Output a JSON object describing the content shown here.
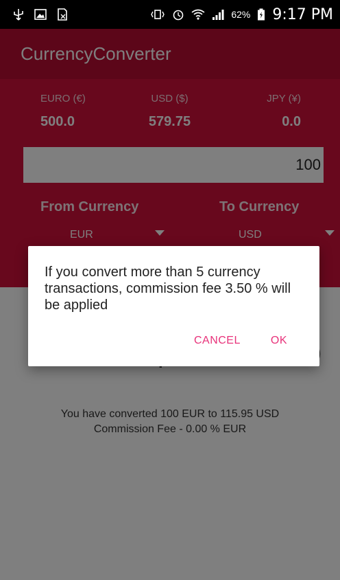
{
  "status_bar": {
    "battery": "62%",
    "time": "9:17 PM"
  },
  "toolbar": {
    "title": "CurrencyConverter"
  },
  "rates": [
    {
      "label": "EURO (€)",
      "value": "500.0"
    },
    {
      "label": "USD ($)",
      "value": "579.75"
    },
    {
      "label": "JPY (¥)",
      "value": "0.0"
    }
  ],
  "amount": {
    "value": "100"
  },
  "from": {
    "label": "From Currency",
    "selected": "EUR"
  },
  "to": {
    "label": "To Currency",
    "selected": "USD"
  },
  "result": {
    "value": "$ 115.95"
  },
  "summary": {
    "line1": "You have converted 100 EUR to 115.95 USD",
    "line2": "Commission Fee - 0.00 % EUR"
  },
  "dialog": {
    "message": "If you convert more than 5 currency transactions, commission fee 3.50 %  will be applied",
    "cancel_label": "CANCEL",
    "ok_label": "OK"
  },
  "colors": {
    "toolbar": "#b80c33",
    "header": "#d1103b",
    "accent": "#e8327a"
  }
}
